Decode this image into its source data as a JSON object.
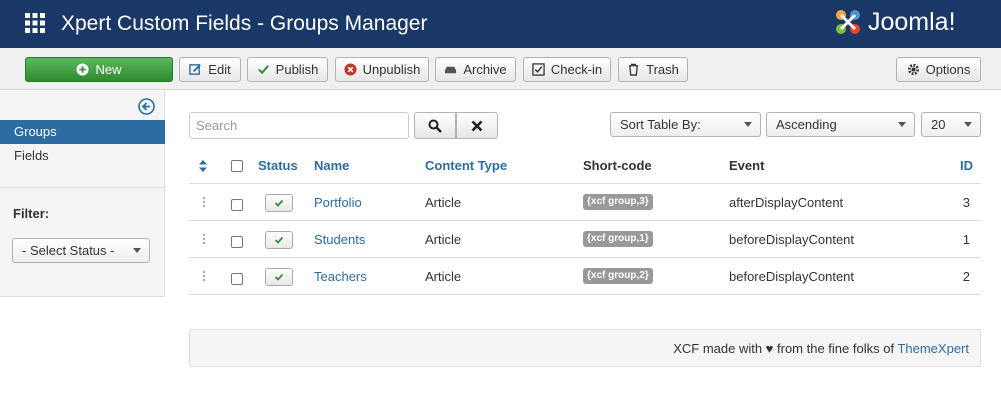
{
  "header": {
    "title": "Xpert Custom Fields - Groups Manager",
    "brand": "Joomla!",
    "bg_color": "#1a3867"
  },
  "toolbar": {
    "new_label": "New",
    "edit_label": "Edit",
    "publish_label": "Publish",
    "unpublish_label": "Unpublish",
    "archive_label": "Archive",
    "checkin_label": "Check-in",
    "trash_label": "Trash",
    "options_label": "Options"
  },
  "sidebar": {
    "items": [
      {
        "label": "Groups",
        "active": true
      },
      {
        "label": "Fields",
        "active": false
      }
    ],
    "filter_label": "Filter:",
    "status_select": "- Select Status -"
  },
  "search": {
    "placeholder": "Search",
    "value": ""
  },
  "sort": {
    "sort_by": "Sort Table By:",
    "direction": "Ascending",
    "limit": "20"
  },
  "table": {
    "headers": {
      "status": "Status",
      "name": "Name",
      "content_type": "Content Type",
      "shortcode": "Short-code",
      "event": "Event",
      "id": "ID"
    },
    "rows": [
      {
        "name": "Portfolio",
        "content_type": "Article",
        "shortcode": "{xcf group,3}",
        "event": "afterDisplayContent",
        "id": "3"
      },
      {
        "name": "Students",
        "content_type": "Article",
        "shortcode": "{xcf group,1}",
        "event": "beforeDisplayContent",
        "id": "1"
      },
      {
        "name": "Teachers",
        "content_type": "Article",
        "shortcode": "{xcf group,2}",
        "event": "beforeDisplayContent",
        "id": "2"
      }
    ]
  },
  "footer": {
    "text_prefix": "XCF made with ♥ from the fine folks of",
    "link_text": "ThemeXpert"
  },
  "colors": {
    "accent": "#2d6ca2",
    "new_button": "#47a447",
    "badge": "#999999"
  }
}
